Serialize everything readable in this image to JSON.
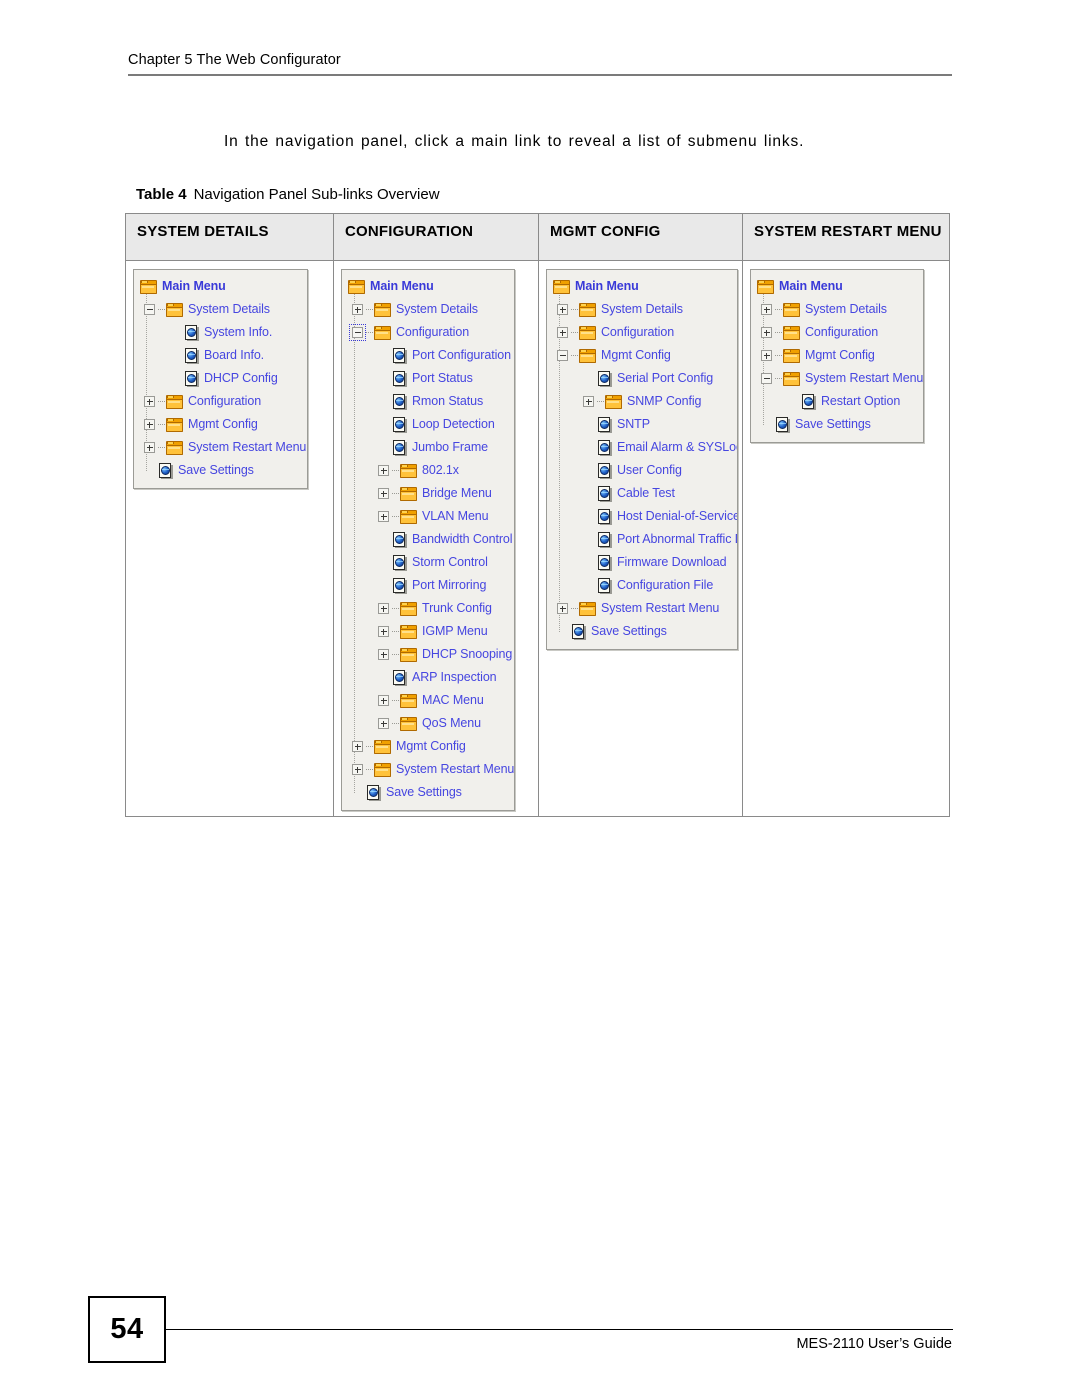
{
  "header": {
    "chapter": "Chapter 5 The Web Configurator"
  },
  "intro": {
    "paragraph": "In the navigation panel, click a main link to reveal a list of submenu links."
  },
  "table_caption": {
    "label": "Table 4",
    "text": "Navigation Panel Sub-links Overview"
  },
  "footer": {
    "page_number": "54",
    "guide": "MES-2110 User’s Guide"
  },
  "colors": {
    "link_text": "#4646e0",
    "header_bg": "#e9e9e9",
    "tree_bg": "#f1f0ec",
    "table_border": "#8a8a8a",
    "folder_icon": "#f0a000"
  },
  "table": {
    "columns": [
      {
        "header": "SYSTEM DETAILS",
        "tree": [
          {
            "label": "Main Menu",
            "depth": 0,
            "icon": "folder-icon",
            "expander": "none",
            "root": true
          },
          {
            "label": "System Details",
            "depth": 1,
            "icon": "folder-icon",
            "expander": "minus"
          },
          {
            "label": "System Info.",
            "depth": 2,
            "icon": "page-icon",
            "expander": "none"
          },
          {
            "label": "Board Info.",
            "depth": 2,
            "icon": "page-icon",
            "expander": "none"
          },
          {
            "label": "DHCP Config",
            "depth": 2,
            "icon": "page-icon",
            "expander": "none"
          },
          {
            "label": "Configuration",
            "depth": 1,
            "icon": "folder-icon",
            "expander": "plus"
          },
          {
            "label": "Mgmt Config",
            "depth": 1,
            "icon": "folder-icon",
            "expander": "plus"
          },
          {
            "label": "System Restart Menu",
            "depth": 1,
            "icon": "folder-icon",
            "expander": "plus"
          },
          {
            "label": "Save Settings",
            "depth": 1,
            "icon": "page-icon",
            "expander": "none"
          }
        ]
      },
      {
        "header": "CONFIGURATION",
        "tree": [
          {
            "label": "Main Menu",
            "depth": 0,
            "icon": "folder-icon",
            "expander": "none",
            "root": true
          },
          {
            "label": "System Details",
            "depth": 1,
            "icon": "folder-icon",
            "expander": "plus"
          },
          {
            "label": "Configuration",
            "depth": 1,
            "icon": "folder-icon",
            "expander": "minus",
            "focused": true
          },
          {
            "label": "Port Configuration",
            "depth": 2,
            "icon": "page-icon",
            "expander": "none"
          },
          {
            "label": "Port Status",
            "depth": 2,
            "icon": "page-icon",
            "expander": "none"
          },
          {
            "label": "Rmon Status",
            "depth": 2,
            "icon": "page-icon",
            "expander": "none"
          },
          {
            "label": "Loop Detection",
            "depth": 2,
            "icon": "page-icon",
            "expander": "none"
          },
          {
            "label": "Jumbo Frame",
            "depth": 2,
            "icon": "page-icon",
            "expander": "none"
          },
          {
            "label": "802.1x",
            "depth": 2,
            "icon": "folder-icon",
            "expander": "plus"
          },
          {
            "label": "Bridge Menu",
            "depth": 2,
            "icon": "folder-icon",
            "expander": "plus"
          },
          {
            "label": "VLAN Menu",
            "depth": 2,
            "icon": "folder-icon",
            "expander": "plus"
          },
          {
            "label": "Bandwidth Control",
            "depth": 2,
            "icon": "page-icon",
            "expander": "none"
          },
          {
            "label": "Storm Control",
            "depth": 2,
            "icon": "page-icon",
            "expander": "none"
          },
          {
            "label": "Port Mirroring",
            "depth": 2,
            "icon": "page-icon",
            "expander": "none"
          },
          {
            "label": "Trunk Config",
            "depth": 2,
            "icon": "folder-icon",
            "expander": "plus"
          },
          {
            "label": "IGMP Menu",
            "depth": 2,
            "icon": "folder-icon",
            "expander": "plus"
          },
          {
            "label": "DHCP Snooping",
            "depth": 2,
            "icon": "folder-icon",
            "expander": "plus"
          },
          {
            "label": "ARP Inspection",
            "depth": 2,
            "icon": "page-icon",
            "expander": "none"
          },
          {
            "label": "MAC Menu",
            "depth": 2,
            "icon": "folder-icon",
            "expander": "plus"
          },
          {
            "label": "QoS Menu",
            "depth": 2,
            "icon": "folder-icon",
            "expander": "plus"
          },
          {
            "label": "Mgmt Config",
            "depth": 1,
            "icon": "folder-icon",
            "expander": "plus"
          },
          {
            "label": "System Restart Menu",
            "depth": 1,
            "icon": "folder-icon",
            "expander": "plus"
          },
          {
            "label": "Save Settings",
            "depth": 1,
            "icon": "page-icon",
            "expander": "none"
          }
        ]
      },
      {
        "header": "MGMT CONFIG",
        "tree": [
          {
            "label": "Main Menu",
            "depth": 0,
            "icon": "folder-icon",
            "expander": "none",
            "root": true
          },
          {
            "label": "System Details",
            "depth": 1,
            "icon": "folder-icon",
            "expander": "plus"
          },
          {
            "label": "Configuration",
            "depth": 1,
            "icon": "folder-icon",
            "expander": "plus"
          },
          {
            "label": "Mgmt Config",
            "depth": 1,
            "icon": "folder-icon",
            "expander": "minus"
          },
          {
            "label": "Serial Port Config",
            "depth": 2,
            "icon": "page-icon",
            "expander": "none"
          },
          {
            "label": "SNMP Config",
            "depth": 2,
            "icon": "folder-icon",
            "expander": "plus"
          },
          {
            "label": "SNTP",
            "depth": 2,
            "icon": "page-icon",
            "expander": "none"
          },
          {
            "label": "Email Alarm & SYSLog",
            "depth": 2,
            "icon": "page-icon",
            "expander": "none"
          },
          {
            "label": "User Config",
            "depth": 2,
            "icon": "page-icon",
            "expander": "none"
          },
          {
            "label": "Cable Test",
            "depth": 2,
            "icon": "page-icon",
            "expander": "none"
          },
          {
            "label": "Host Denial-of-Service",
            "depth": 2,
            "icon": "page-icon",
            "expander": "none"
          },
          {
            "label": "Port Abnormal Traffic Detect",
            "depth": 2,
            "icon": "page-icon",
            "expander": "none"
          },
          {
            "label": "Firmware Download",
            "depth": 2,
            "icon": "page-icon",
            "expander": "none"
          },
          {
            "label": "Configuration File",
            "depth": 2,
            "icon": "page-icon",
            "expander": "none"
          },
          {
            "label": "System Restart Menu",
            "depth": 1,
            "icon": "folder-icon",
            "expander": "plus"
          },
          {
            "label": "Save Settings",
            "depth": 1,
            "icon": "page-icon",
            "expander": "none"
          }
        ]
      },
      {
        "header": "SYSTEM RESTART MENU",
        "tree": [
          {
            "label": "Main Menu",
            "depth": 0,
            "icon": "folder-icon",
            "expander": "none",
            "root": true
          },
          {
            "label": "System Details",
            "depth": 1,
            "icon": "folder-icon",
            "expander": "plus"
          },
          {
            "label": "Configuration",
            "depth": 1,
            "icon": "folder-icon",
            "expander": "plus"
          },
          {
            "label": "Mgmt Config",
            "depth": 1,
            "icon": "folder-icon",
            "expander": "plus"
          },
          {
            "label": "System Restart Menu",
            "depth": 1,
            "icon": "folder-icon",
            "expander": "minus"
          },
          {
            "label": "Restart Option",
            "depth": 2,
            "icon": "page-icon",
            "expander": "none"
          },
          {
            "label": "Save Settings",
            "depth": 1,
            "icon": "page-icon",
            "expander": "none"
          }
        ]
      }
    ]
  }
}
